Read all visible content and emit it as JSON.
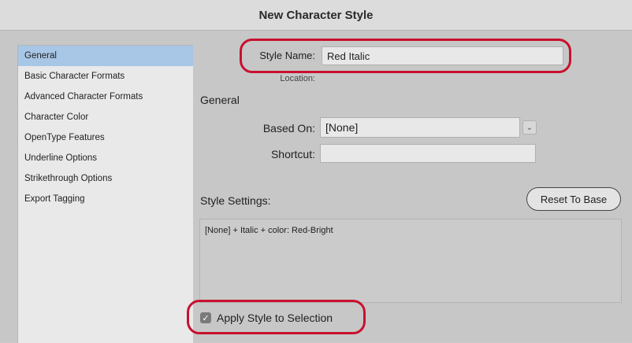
{
  "window": {
    "title": "New Character Style"
  },
  "sidebar": {
    "items": [
      {
        "label": "General",
        "selected": true
      },
      {
        "label": "Basic Character Formats",
        "selected": false
      },
      {
        "label": "Advanced Character Formats",
        "selected": false
      },
      {
        "label": "Character Color",
        "selected": false
      },
      {
        "label": "OpenType Features",
        "selected": false
      },
      {
        "label": "Underline Options",
        "selected": false
      },
      {
        "label": "Strikethrough Options",
        "selected": false
      },
      {
        "label": "Export Tagging",
        "selected": false
      }
    ]
  },
  "form": {
    "style_name_label": "Style Name:",
    "style_name_value": "Red Italic",
    "location_label": "Location:",
    "section_title": "General",
    "based_on_label": "Based On:",
    "based_on_value": "[None]",
    "shortcut_label": "Shortcut:",
    "shortcut_value": "",
    "style_settings_label": "Style Settings:",
    "reset_button_label": "Reset To Base",
    "style_settings_text": "[None] + Italic + color: Red-Bright",
    "apply_style_label": "Apply Style to Selection",
    "apply_style_checked": true
  },
  "colors": {
    "highlight": "#c8102e",
    "selection": "#a8c6e6"
  },
  "icons": {
    "dropdown": "chevron-down-icon",
    "checkbox": "checkmark-icon"
  }
}
